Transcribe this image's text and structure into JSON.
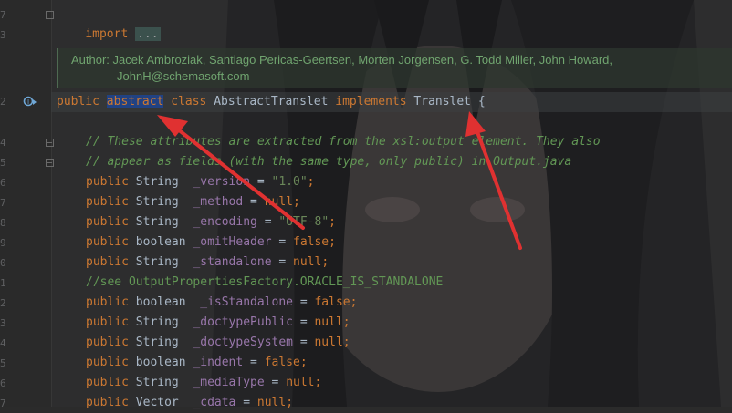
{
  "editor": {
    "line_numbers": [
      "7",
      "3",
      "",
      "",
      "",
      "",
      "2",
      "",
      "",
      "4",
      "5",
      "6",
      "7",
      "8",
      "9",
      "0",
      "1",
      "2",
      "3",
      "4",
      "5",
      "6",
      "7",
      "8",
      "9"
    ],
    "import_line": {
      "keyword": "import",
      "folded": "..."
    },
    "doc_comment": {
      "line1": "Author: Jacek Ambroziak, Santiago Pericas-Geertsen, Morten Jorgensen, G. Todd Miller, John Howard,",
      "line2": "JohnH@schemasoft.com"
    },
    "class_decl": {
      "public": "public",
      "abstract": "abstract",
      "class": "class",
      "name": "AbstractTranslet",
      "implements": "implements",
      "interface": "Translet",
      "brace": "{"
    },
    "comment1": "// These attributes are extracted from the xsl:output element. They also",
    "comment2": "// appear as fields (with the same type, only public) in Output.java",
    "fields": [
      {
        "mod": "public",
        "type": "String",
        "sp": "  ",
        "name": "_version",
        "eq": " = ",
        "val": "\"1.0\"",
        "val_kind": "str",
        "end": ";"
      },
      {
        "mod": "public",
        "type": "String",
        "sp": "  ",
        "name": "_method",
        "eq": " = ",
        "val": "null",
        "val_kind": "kw",
        "end": ";"
      },
      {
        "mod": "public",
        "type": "String",
        "sp": "  ",
        "name": "_encoding",
        "eq": " = ",
        "val": "\"UTF-8\"",
        "val_kind": "str",
        "end": ";"
      },
      {
        "mod": "public",
        "type": "boolean",
        "sp": " ",
        "name": "_omitHeader",
        "eq": " = ",
        "val": "false",
        "val_kind": "kw",
        "end": ";"
      },
      {
        "mod": "public",
        "type": "String",
        "sp": "  ",
        "name": "_standalone",
        "eq": " = ",
        "val": "null",
        "val_kind": "kw",
        "end": ";"
      }
    ],
    "comment3_prefix": "//see ",
    "comment3_ref": "OutputPropertiesFactory.ORACLE_IS_STANDALONE",
    "fields2": [
      {
        "mod": "public",
        "type": "boolean",
        "sp": "  ",
        "name": "_isStandalone",
        "eq": " = ",
        "val": "false",
        "val_kind": "kw",
        "end": ";"
      },
      {
        "mod": "public",
        "type": "String",
        "sp": "  ",
        "name": "_doctypePublic",
        "eq": " = ",
        "val": "null",
        "val_kind": "kw",
        "end": ";"
      },
      {
        "mod": "public",
        "type": "String",
        "sp": "  ",
        "name": "_doctypeSystem",
        "eq": " = ",
        "val": "null",
        "val_kind": "kw",
        "end": ";"
      },
      {
        "mod": "public",
        "type": "boolean",
        "sp": " ",
        "name": "_indent",
        "eq": " = ",
        "val": "false",
        "val_kind": "kw",
        "end": ";"
      },
      {
        "mod": "public",
        "type": "String",
        "sp": "  ",
        "name": "_mediaType",
        "eq": " = ",
        "val": "null",
        "val_kind": "kw",
        "end": ";"
      },
      {
        "mod": "public",
        "type": "Vector",
        "sp": "  ",
        "name": "_cdata",
        "eq": " = ",
        "val": "null",
        "val_kind": "kw",
        "end": ";"
      }
    ]
  },
  "colors": {
    "keyword": "#cc7832",
    "field": "#9876aa",
    "string": "#6a8759",
    "comment": "#629755",
    "plain": "#a9b7c6",
    "annotation_arrow": "#e03131"
  }
}
